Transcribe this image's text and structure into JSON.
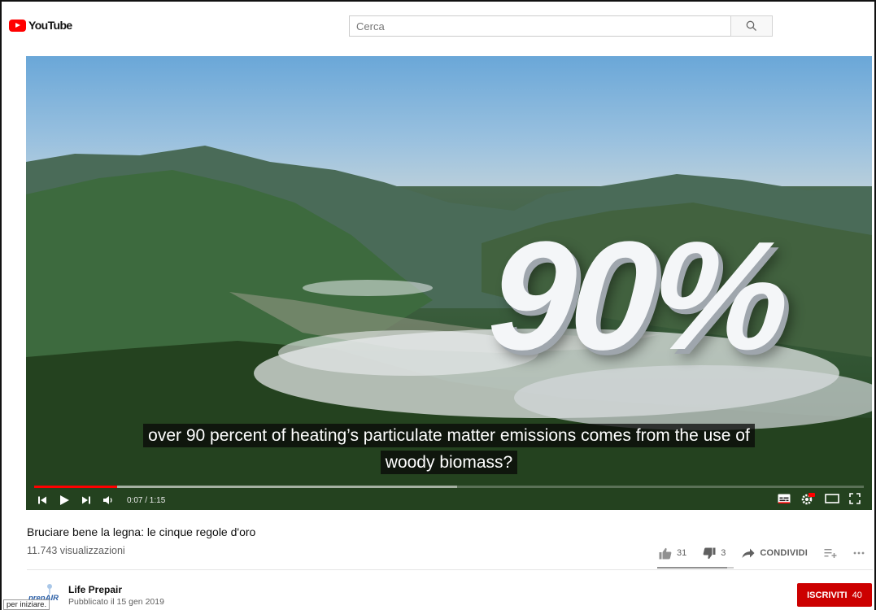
{
  "brand": {
    "logo_text": "YouTube",
    "accent": "#ff0000"
  },
  "search": {
    "placeholder": "Cerca",
    "value": ""
  },
  "player": {
    "overlay_number": "90%",
    "captions": [
      "over 90 percent of heating’s particulate matter emissions comes from the use of",
      "woody biomass?"
    ],
    "current_time": "0:07",
    "duration": "1:15",
    "time_display": "0:07 / 1:15",
    "progress_played": 0.1,
    "progress_buffered": 0.51,
    "icons": [
      "previous-icon",
      "play-icon",
      "next-icon",
      "volume-icon",
      "subtitles-icon",
      "settings-icon",
      "theater-mode-icon",
      "fullscreen-icon"
    ]
  },
  "video": {
    "title": "Bruciare bene la legna: le cinque regole d'oro",
    "views": "11.743 visualizzazioni"
  },
  "actions": {
    "likes": "31",
    "dislikes": "3",
    "share_label": "CONDIVIDI",
    "like_ratio": 0.91
  },
  "channel": {
    "name": "Life Prepair",
    "avatar_text": "prepAIR",
    "published": "Pubblicato il 15 gen 2019"
  },
  "subscribe": {
    "label": "ISCRIVITI",
    "count": "40",
    "color": "#cc0000"
  },
  "status_tip": "per iniziare."
}
